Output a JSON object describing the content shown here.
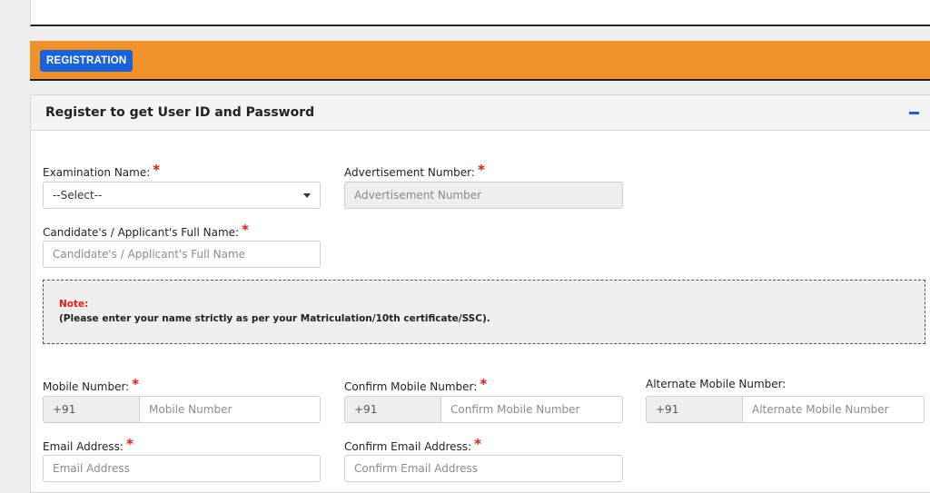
{
  "registration_button": "REGISTRATION",
  "panel": {
    "title": "Register to get User ID and Password",
    "collapse_symbol": "−"
  },
  "form": {
    "exam_name": {
      "label": "Examination Name:",
      "required": "*",
      "value": "--Select--"
    },
    "advertisement_number": {
      "label": "Advertisement Number:",
      "required": "*",
      "placeholder": "Advertisement Number"
    },
    "full_name": {
      "label": "Candidate's / Applicant's Full Name:",
      "required": "*",
      "placeholder": "Candidate's / Applicant's Full Name"
    },
    "note": {
      "title": "Note:",
      "text": "(Please enter your name strictly as per your Matriculation/10th certificate/SSC)."
    },
    "mobile": {
      "label": "Mobile Number:",
      "required": "*",
      "prefix": "+91",
      "placeholder": "Mobile Number"
    },
    "confirm_mobile": {
      "label": "Confirm Mobile Number:",
      "required": "*",
      "prefix": "+91",
      "placeholder": "Confirm Mobile Number"
    },
    "alt_mobile": {
      "label": "Alternate Mobile Number:",
      "prefix": "+91",
      "placeholder": "Alternate Mobile Number"
    },
    "email": {
      "label": "Email Address:",
      "required": "*",
      "placeholder": "Email Address"
    },
    "confirm_email": {
      "label": "Confirm Email Address:",
      "required": "*",
      "placeholder": "Confirm Email Address"
    }
  },
  "colors": {
    "orange_bar": "#f0922b",
    "primary_blue": "#1a63d6",
    "required_red": "#e01b1b"
  }
}
